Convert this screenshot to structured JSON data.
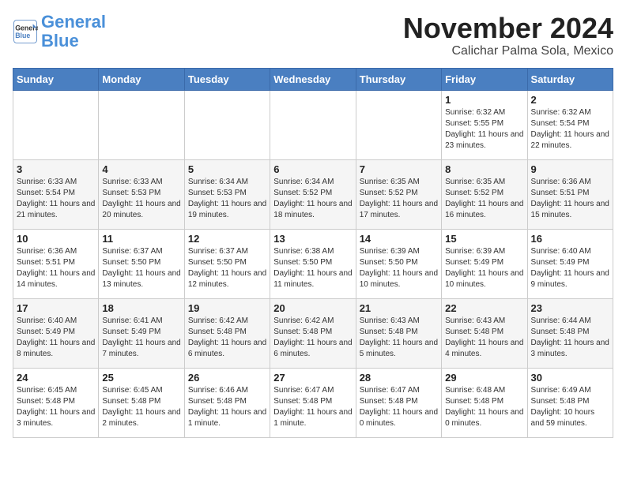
{
  "logo": {
    "text1": "General",
    "text2": "Blue"
  },
  "title": "November 2024",
  "subtitle": "Calichar Palma Sola, Mexico",
  "days_of_week": [
    "Sunday",
    "Monday",
    "Tuesday",
    "Wednesday",
    "Thursday",
    "Friday",
    "Saturday"
  ],
  "weeks": [
    [
      {
        "day": "",
        "info": ""
      },
      {
        "day": "",
        "info": ""
      },
      {
        "day": "",
        "info": ""
      },
      {
        "day": "",
        "info": ""
      },
      {
        "day": "",
        "info": ""
      },
      {
        "day": "1",
        "info": "Sunrise: 6:32 AM\nSunset: 5:55 PM\nDaylight: 11 hours and 23 minutes."
      },
      {
        "day": "2",
        "info": "Sunrise: 6:32 AM\nSunset: 5:54 PM\nDaylight: 11 hours and 22 minutes."
      }
    ],
    [
      {
        "day": "3",
        "info": "Sunrise: 6:33 AM\nSunset: 5:54 PM\nDaylight: 11 hours and 21 minutes."
      },
      {
        "day": "4",
        "info": "Sunrise: 6:33 AM\nSunset: 5:53 PM\nDaylight: 11 hours and 20 minutes."
      },
      {
        "day": "5",
        "info": "Sunrise: 6:34 AM\nSunset: 5:53 PM\nDaylight: 11 hours and 19 minutes."
      },
      {
        "day": "6",
        "info": "Sunrise: 6:34 AM\nSunset: 5:52 PM\nDaylight: 11 hours and 18 minutes."
      },
      {
        "day": "7",
        "info": "Sunrise: 6:35 AM\nSunset: 5:52 PM\nDaylight: 11 hours and 17 minutes."
      },
      {
        "day": "8",
        "info": "Sunrise: 6:35 AM\nSunset: 5:52 PM\nDaylight: 11 hours and 16 minutes."
      },
      {
        "day": "9",
        "info": "Sunrise: 6:36 AM\nSunset: 5:51 PM\nDaylight: 11 hours and 15 minutes."
      }
    ],
    [
      {
        "day": "10",
        "info": "Sunrise: 6:36 AM\nSunset: 5:51 PM\nDaylight: 11 hours and 14 minutes."
      },
      {
        "day": "11",
        "info": "Sunrise: 6:37 AM\nSunset: 5:50 PM\nDaylight: 11 hours and 13 minutes."
      },
      {
        "day": "12",
        "info": "Sunrise: 6:37 AM\nSunset: 5:50 PM\nDaylight: 11 hours and 12 minutes."
      },
      {
        "day": "13",
        "info": "Sunrise: 6:38 AM\nSunset: 5:50 PM\nDaylight: 11 hours and 11 minutes."
      },
      {
        "day": "14",
        "info": "Sunrise: 6:39 AM\nSunset: 5:50 PM\nDaylight: 11 hours and 10 minutes."
      },
      {
        "day": "15",
        "info": "Sunrise: 6:39 AM\nSunset: 5:49 PM\nDaylight: 11 hours and 10 minutes."
      },
      {
        "day": "16",
        "info": "Sunrise: 6:40 AM\nSunset: 5:49 PM\nDaylight: 11 hours and 9 minutes."
      }
    ],
    [
      {
        "day": "17",
        "info": "Sunrise: 6:40 AM\nSunset: 5:49 PM\nDaylight: 11 hours and 8 minutes."
      },
      {
        "day": "18",
        "info": "Sunrise: 6:41 AM\nSunset: 5:49 PM\nDaylight: 11 hours and 7 minutes."
      },
      {
        "day": "19",
        "info": "Sunrise: 6:42 AM\nSunset: 5:48 PM\nDaylight: 11 hours and 6 minutes."
      },
      {
        "day": "20",
        "info": "Sunrise: 6:42 AM\nSunset: 5:48 PM\nDaylight: 11 hours and 6 minutes."
      },
      {
        "day": "21",
        "info": "Sunrise: 6:43 AM\nSunset: 5:48 PM\nDaylight: 11 hours and 5 minutes."
      },
      {
        "day": "22",
        "info": "Sunrise: 6:43 AM\nSunset: 5:48 PM\nDaylight: 11 hours and 4 minutes."
      },
      {
        "day": "23",
        "info": "Sunrise: 6:44 AM\nSunset: 5:48 PM\nDaylight: 11 hours and 3 minutes."
      }
    ],
    [
      {
        "day": "24",
        "info": "Sunrise: 6:45 AM\nSunset: 5:48 PM\nDaylight: 11 hours and 3 minutes."
      },
      {
        "day": "25",
        "info": "Sunrise: 6:45 AM\nSunset: 5:48 PM\nDaylight: 11 hours and 2 minutes."
      },
      {
        "day": "26",
        "info": "Sunrise: 6:46 AM\nSunset: 5:48 PM\nDaylight: 11 hours and 1 minute."
      },
      {
        "day": "27",
        "info": "Sunrise: 6:47 AM\nSunset: 5:48 PM\nDaylight: 11 hours and 1 minute."
      },
      {
        "day": "28",
        "info": "Sunrise: 6:47 AM\nSunset: 5:48 PM\nDaylight: 11 hours and 0 minutes."
      },
      {
        "day": "29",
        "info": "Sunrise: 6:48 AM\nSunset: 5:48 PM\nDaylight: 11 hours and 0 minutes."
      },
      {
        "day": "30",
        "info": "Sunrise: 6:49 AM\nSunset: 5:48 PM\nDaylight: 10 hours and 59 minutes."
      }
    ]
  ]
}
